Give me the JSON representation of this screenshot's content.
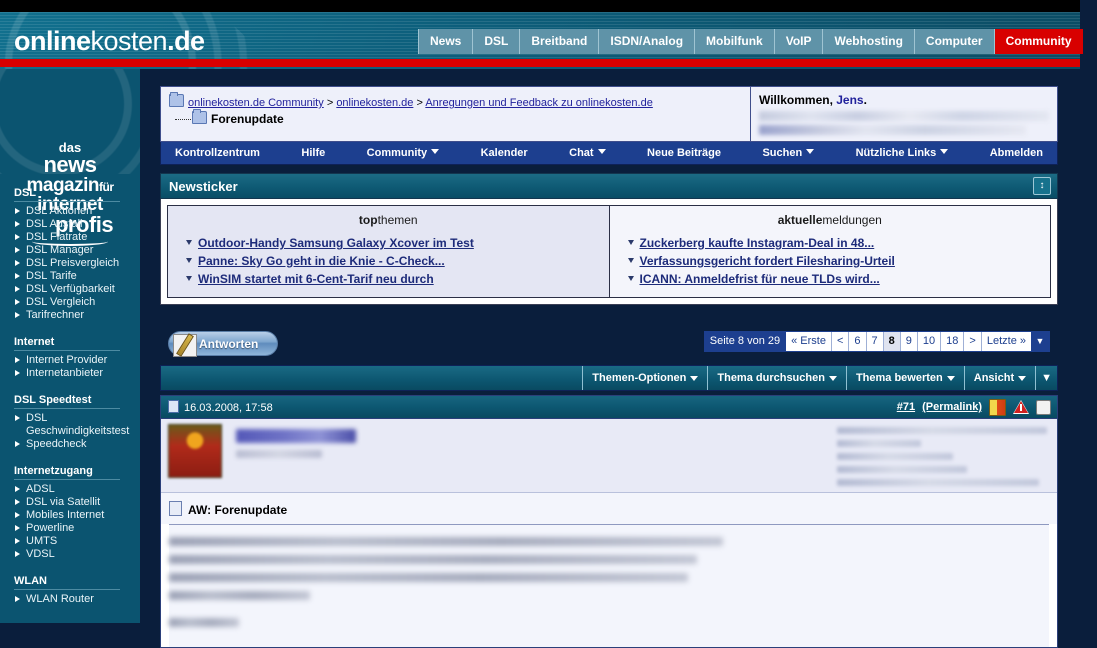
{
  "site": {
    "logo_bold": "online",
    "logo_thin": "kosten",
    "logo_tld": ".de",
    "slogan": {
      "l1": "das",
      "l2": "news",
      "l3": "magazin",
      "l3_small": "für",
      "l4": "internet",
      "l5": "profis"
    }
  },
  "topnav": {
    "items": [
      {
        "label": "News",
        "active": false
      },
      {
        "label": "DSL",
        "active": false
      },
      {
        "label": "Breitband",
        "active": false
      },
      {
        "label": "ISDN/Analog",
        "active": false
      },
      {
        "label": "Mobilfunk",
        "active": false
      },
      {
        "label": "VoIP",
        "active": false
      },
      {
        "label": "Webhosting",
        "active": false
      },
      {
        "label": "Computer",
        "active": false
      },
      {
        "label": "Community",
        "active": true
      }
    ]
  },
  "sidebar": {
    "groups": [
      {
        "title": "DSL",
        "links": [
          "DSL Aktionen",
          "DSL Ausfall",
          "DSL Flatrate",
          "DSL Manager",
          "DSL Preisvergleich",
          "DSL Tarife",
          "DSL Verfügbarkeit",
          "DSL Vergleich",
          "Tarifrechner"
        ]
      },
      {
        "title": "Internet",
        "links": [
          "Internet Provider",
          "Internetanbieter"
        ]
      },
      {
        "title": "DSL Speedtest",
        "links": [
          "DSL Geschwindigkeitstest",
          "Speedcheck"
        ]
      },
      {
        "title": "Internetzugang",
        "links": [
          "ADSL",
          "DSL via Satellit",
          "Mobiles Internet",
          "Powerline",
          "UMTS",
          "VDSL"
        ]
      },
      {
        "title": "WLAN",
        "links": [
          "WLAN Router"
        ]
      }
    ]
  },
  "breadcrumb": {
    "level1": "onlinekosten.de Community",
    "sep1": ">",
    "level2": "onlinekosten.de",
    "sep2": ">",
    "level3": "Anregungen und Feedback zu onlinekosten.de",
    "current": "Forenupdate"
  },
  "welcome": {
    "text_prefix": "Willkommen,",
    "username": "Jens",
    "text_suffix": "."
  },
  "forumnav": {
    "items": [
      {
        "label": "Kontrollzentrum",
        "caret": false
      },
      {
        "label": "Hilfe",
        "caret": false
      },
      {
        "label": "Community",
        "caret": true
      },
      {
        "label": "Kalender",
        "caret": false
      },
      {
        "label": "Chat",
        "caret": true
      },
      {
        "label": "Neue Beiträge",
        "caret": false
      },
      {
        "label": "Suchen",
        "caret": true
      },
      {
        "label": "Nützliche Links",
        "caret": true
      },
      {
        "label": "Abmelden",
        "caret": false
      }
    ]
  },
  "newsticker": {
    "title": "Newsticker",
    "collapse_icon": "collapse-icon",
    "col_left": {
      "head_bold": "top",
      "head_normal": "themen",
      "items": [
        "Outdoor-Handy Samsung Galaxy Xcover im Test",
        "Panne: Sky Go geht in die Knie - C-Check...",
        "WinSIM startet mit 6-Cent-Tarif neu durch"
      ]
    },
    "col_right": {
      "head_bold": "aktuelle",
      "head_normal": "meldungen",
      "items": [
        "Zuckerberg kaufte Instagram-Deal in 48...",
        "Verfassungsgericht fordert Filesharing-Urteil",
        "ICANN: Anmeldefrist für neue TLDs wird..."
      ]
    }
  },
  "toolbar": {
    "reply_label": "Antworten",
    "pager": {
      "label": "Seite 8 von 29",
      "first": "« Erste",
      "prev": "<",
      "pages": [
        "6",
        "7",
        "8",
        "9",
        "10",
        "18"
      ],
      "current": "8",
      "next": ">",
      "last": "Letzte »",
      "drop": "▼"
    },
    "options": [
      {
        "label": "Themen-Optionen",
        "caret": true
      },
      {
        "label": "Thema durchsuchen",
        "caret": true
      },
      {
        "label": "Thema bewerten",
        "caret": true
      },
      {
        "label": "Ansicht",
        "caret": true
      }
    ],
    "options_drop": "▼"
  },
  "post": {
    "date": "16.03.2008, 17:58",
    "number": "#71",
    "permalink": "(Permalink)",
    "title": "AW: Forenupdate"
  },
  "colors": {
    "brand_teal": "#0b5470",
    "brand_red": "#d80000",
    "nav_blue": "#1d3f8f",
    "link_blue": "#22229c",
    "panel_bg": "#e9ecf7"
  }
}
